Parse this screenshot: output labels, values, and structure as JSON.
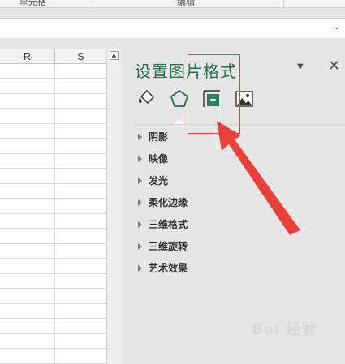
{
  "ribbon": {
    "groups": [
      "单元格",
      "编辑"
    ]
  },
  "formula_bar": {
    "expand_icon": "chevron-down-icon"
  },
  "sheet": {
    "columns": [
      "R",
      "S"
    ],
    "row_count": 21
  },
  "pane": {
    "title": "设置图片格式",
    "menu_icon": "dropdown-triangle-icon",
    "close_label": "✕",
    "tabs": [
      {
        "name": "fill-line",
        "icon": "paint-bucket-icon"
      },
      {
        "name": "effects",
        "icon": "pentagon-icon"
      },
      {
        "name": "size-properties",
        "icon": "size-properties-icon"
      },
      {
        "name": "picture",
        "icon": "picture-icon"
      }
    ],
    "active_tab": "effects",
    "sections": [
      "阴影",
      "映像",
      "发光",
      "柔化边缘",
      "三维格式",
      "三维旋转",
      "艺术效果"
    ]
  },
  "annotation": {
    "color": "#e0413c"
  },
  "watermark": {
    "text": "Bai 经验"
  },
  "colors": {
    "accent": "#217346",
    "pane_bg": "#e6e6e6"
  }
}
